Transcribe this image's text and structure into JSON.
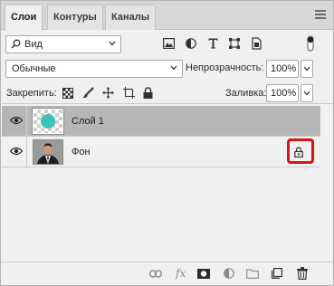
{
  "tabs": [
    {
      "label": "Слои",
      "active": true
    },
    {
      "label": "Контуры",
      "active": false
    },
    {
      "label": "Каналы",
      "active": false
    }
  ],
  "filter": {
    "label": "Вид",
    "icons": [
      "image-filter-icon",
      "adjustment-filter-icon",
      "type-filter-icon",
      "shape-filter-icon",
      "smart-object-filter-icon",
      "filter-toggle-icon"
    ]
  },
  "blend": {
    "mode": "Обычные",
    "opacity_label": "Непрозрачность:",
    "opacity_value": "100%"
  },
  "lock": {
    "label": "Закрепить:",
    "fill_label": "Заливка:",
    "fill_value": "100%"
  },
  "layers": [
    {
      "name": "Слой 1",
      "selected": true,
      "locked": false
    },
    {
      "name": "Фон",
      "selected": false,
      "locked": true
    }
  ],
  "colors": {
    "highlight": "#d41616",
    "selected_row": "#b6b6b6",
    "teal": "#3cc3b6"
  },
  "bottom_icons": [
    "link-layers-icon",
    "fx-icon",
    "layer-mask-icon",
    "adjustment-layer-icon",
    "group-folder-icon",
    "new-layer-icon",
    "trash-icon"
  ],
  "fx_label": "fx"
}
